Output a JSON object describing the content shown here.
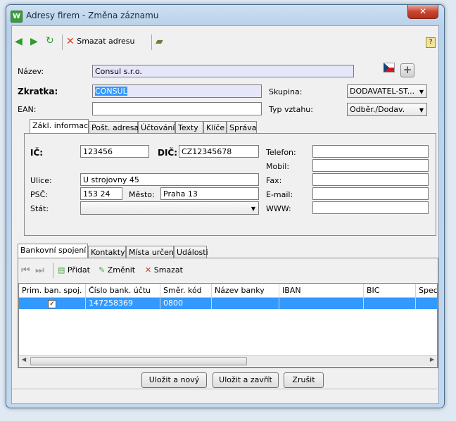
{
  "window": {
    "title": "Adresy firem - Změna záznamu",
    "app_icon": "W",
    "close_symbol": "✕"
  },
  "toolbar": {
    "delete_label": "Smazat adresu"
  },
  "form": {
    "nazev_label": "Název:",
    "nazev_value": "Consul s.r.o.",
    "zkratka_label": "Zkratka:",
    "zkratka_value": "CONSUL",
    "ean_label": "EAN:",
    "ean_value": "",
    "skupina_label": "Skupina:",
    "skupina_value": "DODAVATEL-ST...",
    "typ_vztahu_label": "Typ vztahu:",
    "typ_vztahu_value": "Odběr./Dodav."
  },
  "top_tabs": [
    "Zákl. informace",
    "Pošt. adresa",
    "Účtování",
    "Texty",
    "Klíče",
    "Správa"
  ],
  "basic": {
    "ic_label": "IČ:",
    "ic_value": "123456",
    "dic_label": "DIČ:",
    "dic_value": "CZ12345678",
    "ulice_label": "Ulice:",
    "ulice_value": "U strojovny 45",
    "psc_label": "PSČ:",
    "psc_value": "153 24",
    "mesto_label": "Město:",
    "mesto_value": "Praha 13",
    "stat_label": "Stát:",
    "stat_value": "",
    "telefon_label": "Telefon:",
    "mobil_label": "Mobil:",
    "fax_label": "Fax:",
    "email_label": "E-mail:",
    "www_label": "WWW:"
  },
  "bottom_tabs": [
    "Bankovní spojení",
    "Kontakty",
    "Místa určení",
    "Události"
  ],
  "bank_toolbar": {
    "add": "Přidat",
    "edit": "Změnit",
    "delete": "Smazat"
  },
  "bank_table": {
    "columns": [
      "Prim. ban. spoj.",
      "Číslo bank. účtu",
      "Směr. kód",
      "Název banky",
      "IBAN",
      "BIC",
      "Spec"
    ],
    "rows": [
      {
        "primary": "✓",
        "account": "147258369",
        "code": "0800",
        "bank": "",
        "iban": "",
        "bic": "",
        "spec": ""
      }
    ]
  },
  "buttons": {
    "save_new": "Uložit a nový",
    "save_close": "Uložit a zavřít",
    "cancel": "Zrušit"
  },
  "colors": {
    "selection": "#3399ff",
    "input_highlight": "#e6e6fb"
  }
}
